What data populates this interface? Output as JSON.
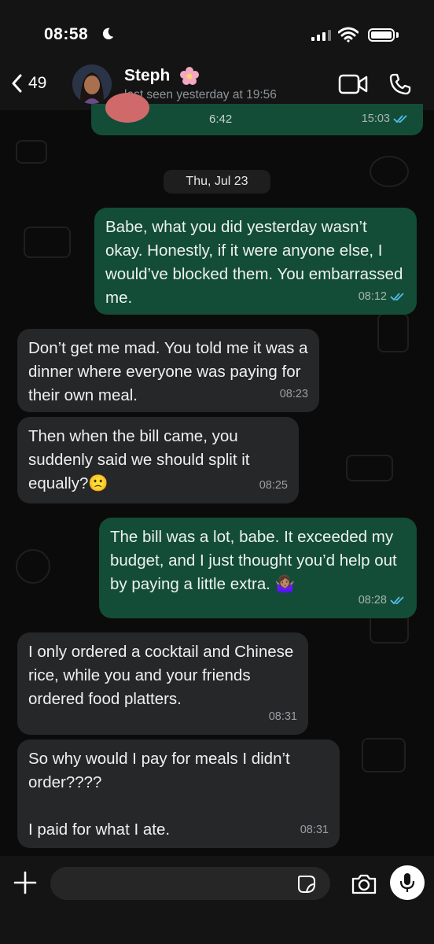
{
  "status_bar": {
    "time": "08:58"
  },
  "header": {
    "back_count": "49",
    "contact_name": "Steph",
    "last_seen": "last seen yesterday at 19:56"
  },
  "top_partial_message": {
    "duration": "6:42",
    "time": "15:03"
  },
  "date_divider": "Thu, Jul 23",
  "messages": [
    {
      "direction": "outgoing",
      "text": "Babe, what you did yesterday wasn’t okay. Honestly, if it were anyone else, I would’ve blocked them. You embarrassed me.",
      "time": "08:12",
      "read": true
    },
    {
      "direction": "incoming",
      "text": "Don’t get me mad. You told me it was a dinner where everyone was paying for their own meal.",
      "time": "08:23"
    },
    {
      "direction": "incoming",
      "text": "Then when the bill came, you suddenly said we should split it equally?🙁",
      "time": "08:25"
    },
    {
      "direction": "outgoing",
      "text": "The bill was a lot, babe. It exceeded my budget, and I just thought you’d help out by paying a little extra. 🤷🏽‍♀️",
      "time": "08:28",
      "read": true
    },
    {
      "direction": "incoming",
      "text": "I only ordered a cocktail and Chinese rice, while you and your friends ordered food platters.",
      "time": "08:31"
    },
    {
      "direction": "incoming",
      "text": "So why would I pay for meals I didn’t order????\n\nI paid for what I ate.",
      "time": "08:31"
    }
  ],
  "colors": {
    "outgoing_bubble": "#134d37",
    "incoming_bubble": "#252728",
    "read_ticks": "#53bdeb",
    "background": "#0b0b0b"
  },
  "icons": [
    "moon-icon",
    "signal-icon",
    "wifi-icon",
    "battery-icon",
    "back-chevron-icon",
    "flower-emoji-icon",
    "video-call-icon",
    "phone-icon",
    "read-ticks-icon",
    "plus-icon",
    "sticker-icon",
    "camera-icon",
    "microphone-icon"
  ]
}
